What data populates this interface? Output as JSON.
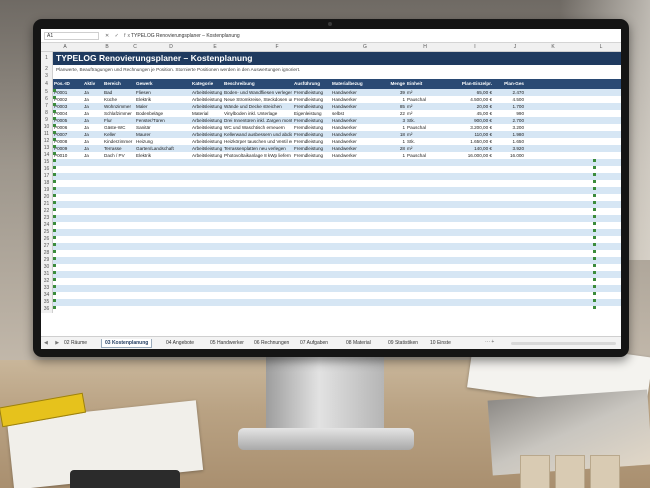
{
  "app": {
    "name_box": "A1",
    "fx": "fx",
    "formula": "TYPELOG Renovierungsplaner – Kostenplanung"
  },
  "columns": [
    "A",
    "B",
    "C",
    "D",
    "E",
    "F",
    "G",
    "H",
    "I",
    "J",
    "K",
    "L"
  ],
  "sheet": {
    "title": "TYPELOG Renovierungsplaner – Kostenplanung",
    "subtitle": "Planwerte, Beauftragungen und Rechnungen je Position. Stornierte Positionen werden in den Auswertungen ignoriert.",
    "headers": [
      "Pos.-ID",
      "Aktiv",
      "Bereich",
      "Gewerk",
      "Kategorie",
      "Beschreibung",
      "Ausführung",
      "Materialbezug",
      "Menge",
      "Einheit",
      "Plan-Einzelpr.",
      "Plan-Ges"
    ],
    "rows": [
      [
        "P0001",
        "Ja",
        "Bad",
        "Fliesen",
        "Arbeitsleistung",
        "Boden- und Wandfliesen verlegen",
        "Fremdleistung",
        "Handwerker",
        "39",
        "m²",
        "65,00 €",
        "2.470"
      ],
      [
        "P0002",
        "Ja",
        "Küche",
        "Elektrik",
        "Arbeitsleistung",
        "Neue Stromkreise, Steckdosen und l",
        "Fremdleistung",
        "Handwerker",
        "1",
        "Pauschal",
        "4.500,00 €",
        "4.500"
      ],
      [
        "P0003",
        "Ja",
        "Wohnzimmer",
        "Maler",
        "Arbeitsleistung",
        "Wände und Decke streichen",
        "Fremdleistung",
        "Handwerker",
        "85",
        "m²",
        "20,00 €",
        "1.700"
      ],
      [
        "P0004",
        "Ja",
        "Schlafzimmer",
        "Bodenbeläge",
        "Material",
        "Vinylboden inkl. Unterlage",
        "Eigenleistung",
        "selbst",
        "22",
        "m²",
        "45,00 €",
        "990"
      ],
      [
        "P0005",
        "Ja",
        "Flur",
        "Fenster/Türen",
        "Arbeitsleistung",
        "Drei Innentüren inkl. Zargen montiere",
        "Fremdleistung",
        "Handwerker",
        "3",
        "Stk.",
        "900,00 €",
        "2.700"
      ],
      [
        "P0006",
        "Ja",
        "Gäste-WC",
        "Sanitär",
        "Arbeitsleistung",
        "WC und Waschtisch erneuern",
        "Fremdleistung",
        "Handwerker",
        "1",
        "Pauschal",
        "3.200,00 €",
        "3.200"
      ],
      [
        "P0007",
        "Ja",
        "Keller",
        "Maurer",
        "Arbeitsleistung",
        "Kellerwand ausbessern und abdichte",
        "Fremdleistung",
        "Handwerker",
        "18",
        "m²",
        "110,00 €",
        "1.980"
      ],
      [
        "P0008",
        "Ja",
        "Kinderzimmer",
        "Heizung",
        "Arbeitsleistung",
        "Heizkörper tauschen und Ventil erne",
        "Fremdleistung",
        "Handwerker",
        "1",
        "Stk.",
        "1.650,00 €",
        "1.650"
      ],
      [
        "P0009",
        "Ja",
        "Terrasse",
        "Garten/Landschaft",
        "Arbeitsleistung",
        "Terrassenplatten neu verlegen",
        "Fremdleistung",
        "Handwerker",
        "28",
        "m²",
        "140,00 €",
        "3.920"
      ],
      [
        "P0010",
        "Ja",
        "Dach / PV",
        "Elektrik",
        "Arbeitsleistung",
        "Photovoltaikanlage 8 kWp liefern und",
        "Fremdleistung",
        "Handwerker",
        "1",
        "Pauschal",
        "16.000,00 €",
        "16.000"
      ]
    ],
    "row_numbers": [
      "1",
      "2",
      "3",
      "4",
      "5",
      "6",
      "7",
      "8",
      "9",
      "10",
      "11",
      "12",
      "13",
      "14",
      "15",
      "16",
      "17",
      "18",
      "19",
      "20",
      "21",
      "22",
      "23",
      "24",
      "25",
      "26",
      "27",
      "28",
      "29",
      "30",
      "31",
      "32",
      "33",
      "34",
      "35",
      "36"
    ]
  },
  "tabs": {
    "nav": "◀ ▶",
    "items": [
      {
        "label": "02 Räume",
        "active": false
      },
      {
        "label": "03 Kostenplanung",
        "active": true
      },
      {
        "label": "04 Angebote",
        "active": false
      },
      {
        "label": "05 Handwerker",
        "active": false
      },
      {
        "label": "06 Rechnungen",
        "active": false
      },
      {
        "label": "07 Aufgaben",
        "active": false
      },
      {
        "label": "08 Material",
        "active": false
      },
      {
        "label": "09 Statistiken",
        "active": false
      },
      {
        "label": "10 Einste",
        "active": false
      }
    ],
    "more": "···",
    "add": "+"
  },
  "colors": {
    "title_bg": "#1f3a5f",
    "header_bg": "#2a4a74",
    "band": "#d6e6f4"
  }
}
